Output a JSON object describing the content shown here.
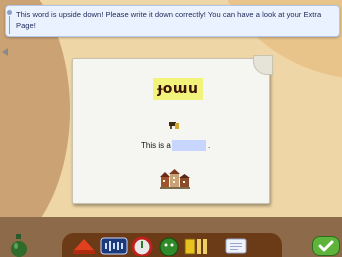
{
  "banner": {
    "message": "This word is upside down! Please write it down correctly! You can have a look at your Extra Page!"
  },
  "exercise": {
    "upside_down_word": "ɟoɯu",
    "sentence_prefix": "This is a",
    "sentence_suffix": ".",
    "answer_value": "",
    "answer_placeholder": ""
  },
  "colors": {
    "banner_bg": "#eaf2ff",
    "banner_text": "#1e2a5a",
    "word_highlight": "#f2f37a",
    "answer_field": "#c8d6ff",
    "toolbar": "#6b3a16",
    "confirm": "#5eb33a"
  },
  "toolbar": {
    "items": [
      {
        "icon": "red-cap-icon"
      },
      {
        "icon": "sound-display-icon"
      },
      {
        "icon": "red-gauge-icon"
      },
      {
        "icon": "green-character-icon"
      },
      {
        "icon": "ruler-tool-icon"
      },
      {
        "icon": "notepad-icon"
      }
    ],
    "confirm_icon": "checkmark-icon",
    "bottle_icon": "bottle-icon"
  }
}
